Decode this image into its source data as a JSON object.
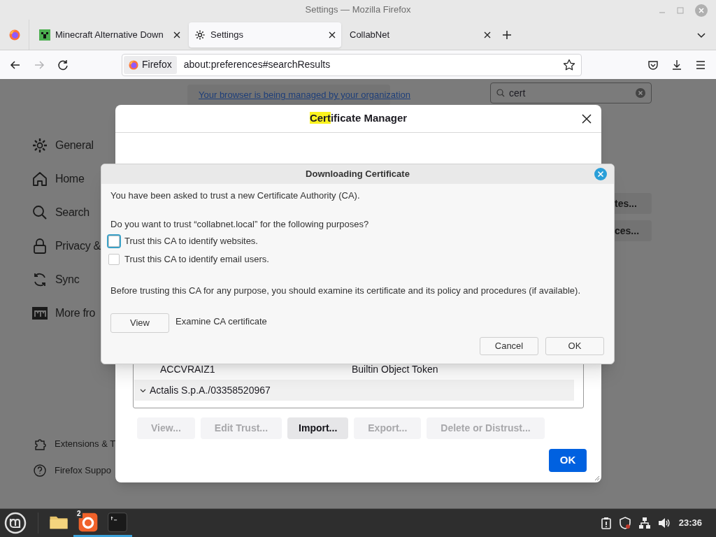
{
  "window": {
    "title": "Settings — Mozilla Firefox"
  },
  "tabs": [
    {
      "label": "Minecraft Alternative Down",
      "selected": false,
      "kind": "minecraft"
    },
    {
      "label": "Settings",
      "selected": true,
      "kind": "settings"
    },
    {
      "label": "CollabNet",
      "selected": false,
      "kind": "blank"
    }
  ],
  "nav_buttons": [
    {
      "kind": "back",
      "disabled": false
    },
    {
      "kind": "forward",
      "disabled": true
    },
    {
      "kind": "reload",
      "disabled": false
    }
  ],
  "address_bar": {
    "identity": "Firefox",
    "url": "about:preferences#searchResults"
  },
  "sidebar": {
    "items": [
      {
        "label": "General",
        "kind": "gear"
      },
      {
        "label": "Home",
        "kind": "home"
      },
      {
        "label": "Search",
        "kind": "search"
      },
      {
        "label": "Privacy &",
        "kind": "lock"
      },
      {
        "label": "Sync",
        "kind": "sync"
      },
      {
        "label": "More fro",
        "kind": "mozilla"
      }
    ],
    "footer": [
      {
        "label": "Extensions & T",
        "kind": "puzzle"
      },
      {
        "label": "Firefox Suppo",
        "kind": "help"
      }
    ]
  },
  "notice": "Your browser is being managed by your organization",
  "search": {
    "value": "cert"
  },
  "background_buttons": [
    "tes...",
    "ces..."
  ],
  "cert_manager": {
    "title_highlight": "Cert",
    "title_rest": "ificate Manager",
    "rows": [
      {
        "kind": "cert",
        "cells": [
          "ACCVRAIZ1",
          "Builtin Object Token"
        ]
      },
      {
        "kind": "group",
        "label": "Actalis S.p.A./03358520967",
        "expanded": true
      }
    ],
    "buttons": [
      {
        "label": "View...",
        "disabled": true
      },
      {
        "label": "Edit Trust...",
        "disabled": true
      },
      {
        "label": "Import...",
        "disabled": false
      },
      {
        "label": "Export...",
        "disabled": true
      },
      {
        "label": "Delete or Distrust...",
        "disabled": true
      }
    ],
    "ok": "OK"
  },
  "download_dialog": {
    "title": "Downloading Certificate",
    "intro": "You have been asked to trust a new Certificate Authority (CA).",
    "question": "Do you want to trust “collabnet.local” for the following purposes?",
    "options": [
      {
        "label": "Trust this CA to identify websites.",
        "checked": false,
        "focused": true
      },
      {
        "label": "Trust this CA to identify email users.",
        "checked": false,
        "focused": false
      }
    ],
    "warning": "Before trusting this CA for any purpose, you should examine its certificate and its policy and procedures (if available).",
    "view_button": "View",
    "view_label": "Examine CA certificate",
    "buttons": [
      "Cancel",
      "OK"
    ]
  },
  "taskbar": {
    "apps": [
      {
        "kind": "files",
        "running": false
      },
      {
        "kind": "firefox",
        "running": true,
        "badge": "2"
      },
      {
        "kind": "terminal",
        "running": true
      }
    ],
    "clock": "23:36"
  }
}
